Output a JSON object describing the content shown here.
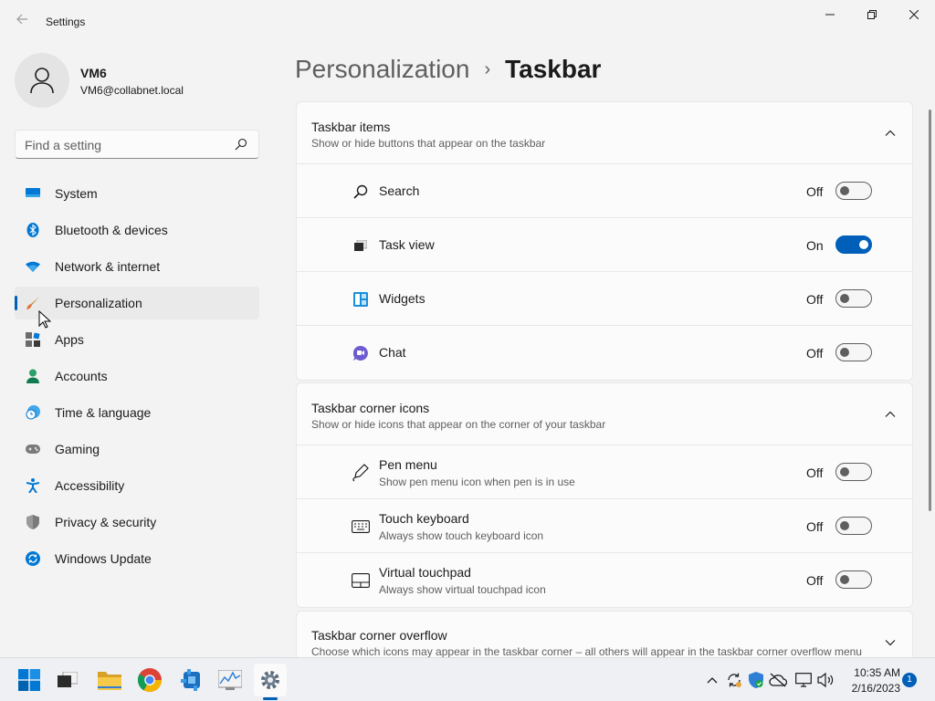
{
  "window": {
    "title": "Settings"
  },
  "user": {
    "name": "VM6",
    "email": "VM6@collabnet.local"
  },
  "search": {
    "placeholder": "Find a setting"
  },
  "nav": {
    "items": [
      {
        "label": "System",
        "icon": "monitor-icon"
      },
      {
        "label": "Bluetooth & devices",
        "icon": "bluetooth-icon"
      },
      {
        "label": "Network & internet",
        "icon": "wifi-icon"
      },
      {
        "label": "Personalization",
        "icon": "brush-icon",
        "active": true
      },
      {
        "label": "Apps",
        "icon": "apps-icon"
      },
      {
        "label": "Accounts",
        "icon": "person-icon"
      },
      {
        "label": "Time & language",
        "icon": "clock-globe-icon"
      },
      {
        "label": "Gaming",
        "icon": "gamepad-icon"
      },
      {
        "label": "Accessibility",
        "icon": "accessibility-icon"
      },
      {
        "label": "Privacy & security",
        "icon": "shield-icon"
      },
      {
        "label": "Windows Update",
        "icon": "update-icon"
      }
    ]
  },
  "header": {
    "parent": "Personalization",
    "separator": "›",
    "current": "Taskbar"
  },
  "taskbar_items": {
    "title": "Taskbar items",
    "subtitle": "Show or hide buttons that appear on the taskbar",
    "rows": [
      {
        "label": "Search",
        "state": "Off",
        "on": false,
        "icon": "search-icon"
      },
      {
        "label": "Task view",
        "state": "On",
        "on": true,
        "icon": "task-view-icon"
      },
      {
        "label": "Widgets",
        "state": "Off",
        "on": false,
        "icon": "widgets-icon"
      },
      {
        "label": "Chat",
        "state": "Off",
        "on": false,
        "icon": "chat-icon"
      }
    ]
  },
  "corner_icons": {
    "title": "Taskbar corner icons",
    "subtitle": "Show or hide icons that appear on the corner of your taskbar",
    "rows": [
      {
        "label": "Pen menu",
        "desc": "Show pen menu icon when pen is in use",
        "state": "Off",
        "on": false,
        "icon": "pen-icon"
      },
      {
        "label": "Touch keyboard",
        "desc": "Always show touch keyboard icon",
        "state": "Off",
        "on": false,
        "icon": "keyboard-icon"
      },
      {
        "label": "Virtual touchpad",
        "desc": "Always show virtual touchpad icon",
        "state": "Off",
        "on": false,
        "icon": "touchpad-icon"
      }
    ]
  },
  "corner_overflow": {
    "title": "Taskbar corner overflow",
    "subtitle": "Choose which icons may appear in the taskbar corner – all others will appear in the taskbar corner overflow menu"
  },
  "system_taskbar": {
    "time": "10:35 AM",
    "date": "2/16/2023",
    "notifications": "1"
  },
  "colors": {
    "accent": "#005fb8",
    "background": "#f3f3f3",
    "card": "#fbfbfb"
  }
}
